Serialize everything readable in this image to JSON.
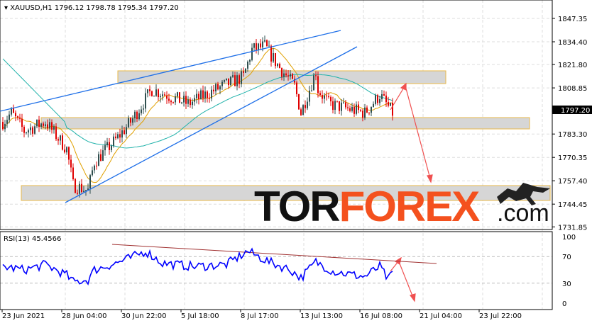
{
  "header": {
    "symbol": "XAUUSD,H1",
    "ohlc": "1796.12 1798.78 1795.34 1797.20"
  },
  "rsi_label": "RSI(13) 45.4566",
  "logo": {
    "part1": "TOR",
    "part2": "FOREX",
    "part3": ".com",
    "accent": "#f4511e"
  },
  "chart_data": {
    "type": "candlestick",
    "title": "XAUUSD,H1",
    "y_ticks": [
      "1847.35",
      "1834.40",
      "1821.80",
      "1808.85",
      "1783.30",
      "1770.35",
      "1757.40",
      "1744.45",
      "1731.85"
    ],
    "y_values": [
      1847.35,
      1834.4,
      1821.8,
      1808.85,
      1783.3,
      1770.35,
      1757.4,
      1744.45,
      1731.85
    ],
    "current_price": "1797.20",
    "x_ticks": [
      "23 Jun 2021",
      "28 Jun 04:00",
      "30 Jun 22:00",
      "5 Jul 18:00",
      "8 Jul 17:00",
      "13 Jul 13:00",
      "16 Jul 08:00",
      "21 Jul 04:00",
      "23 Jul 22:00"
    ],
    "price_path": [
      [
        0,
        1790
      ],
      [
        4,
        1795
      ],
      [
        10,
        1785
      ],
      [
        20,
        1790
      ],
      [
        30,
        1775
      ],
      [
        33,
        1755
      ],
      [
        40,
        1752
      ],
      [
        43,
        1768
      ],
      [
        53,
        1780
      ],
      [
        60,
        1790
      ],
      [
        70,
        1808
      ],
      [
        77,
        1805
      ],
      [
        87,
        1800
      ],
      [
        100,
        1808
      ],
      [
        113,
        1815
      ],
      [
        117,
        1830
      ],
      [
        123,
        1832
      ],
      [
        130,
        1820
      ],
      [
        137,
        1810
      ],
      [
        140,
        1795
      ],
      [
        147,
        1818
      ],
      [
        148,
        1808
      ],
      [
        153,
        1800
      ],
      [
        163,
        1797
      ],
      [
        170,
        1795
      ],
      [
        177,
        1805
      ],
      [
        183,
        1795
      ]
    ],
    "rsi": {
      "ticks": [
        "100",
        "70",
        "30",
        "0"
      ],
      "levels": [
        100,
        70,
        30,
        0
      ],
      "path": [
        [
          0,
          55
        ],
        [
          10,
          50
        ],
        [
          20,
          58
        ],
        [
          30,
          42
        ],
        [
          33,
          32
        ],
        [
          40,
          35
        ],
        [
          43,
          50
        ],
        [
          53,
          60
        ],
        [
          60,
          68
        ],
        [
          67,
          78
        ],
        [
          75,
          60
        ],
        [
          90,
          55
        ],
        [
          105,
          58
        ],
        [
          115,
          78
        ],
        [
          125,
          62
        ],
        [
          135,
          50
        ],
        [
          140,
          38
        ],
        [
          147,
          62
        ],
        [
          155,
          48
        ],
        [
          165,
          42
        ],
        [
          170,
          40
        ],
        [
          177,
          55
        ],
        [
          181,
          35
        ],
        [
          183,
          45
        ]
      ]
    },
    "colors": {
      "up": "#2f4f4f",
      "down": "#e00000",
      "ma_fast": "#e0a000",
      "ma_slow": "#20b2aa",
      "trend": "#1e6fe8",
      "rsi": "#0000ff"
    }
  }
}
